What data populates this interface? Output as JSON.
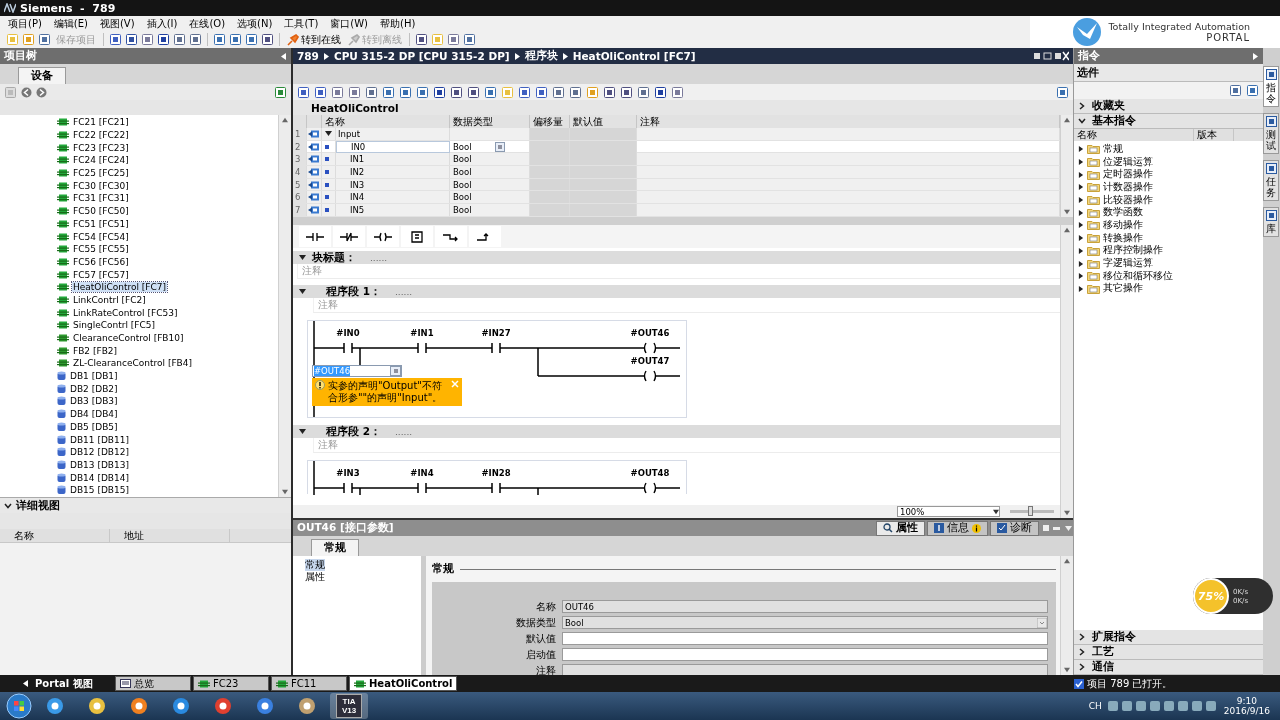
{
  "title_bar": {
    "title": "Siemens  -  789"
  },
  "brand": {
    "line1": "Totally Integrated Automation",
    "line2": "PORTAL"
  },
  "menu": [
    "项目(P)",
    "编辑(E)",
    "视图(V)",
    "插入(I)",
    "在线(O)",
    "选项(N)",
    "工具(T)",
    "窗口(W)",
    "帮助(H)"
  ],
  "toolbar": {
    "buttons": [
      {
        "label": "保存项目",
        "disabled": true
      },
      {
        "label": "转到在线",
        "disabled": false
      },
      {
        "label": "转到离线",
        "disabled": true
      }
    ]
  },
  "project_tree": {
    "title": "项目树",
    "tab": "设备",
    "items": [
      {
        "label": "FC21 [FC21]",
        "kind": "fc",
        "selected": false
      },
      {
        "label": "FC22 [FC22]",
        "kind": "fc",
        "selected": false
      },
      {
        "label": "FC23 [FC23]",
        "kind": "fc",
        "selected": false
      },
      {
        "label": "FC24 [FC24]",
        "kind": "fc",
        "selected": false
      },
      {
        "label": "FC25 [FC25]",
        "kind": "fc",
        "selected": false
      },
      {
        "label": "FC30 [FC30]",
        "kind": "fc",
        "selected": false
      },
      {
        "label": "FC31 [FC31]",
        "kind": "fc",
        "selected": false
      },
      {
        "label": "FC50 [FC50]",
        "kind": "fc",
        "selected": false
      },
      {
        "label": "FC51 [FC51]",
        "kind": "fc",
        "selected": false
      },
      {
        "label": "FC54 [FC54]",
        "kind": "fc",
        "selected": false
      },
      {
        "label": "FC55 [FC55]",
        "kind": "fc",
        "selected": false
      },
      {
        "label": "FC56 [FC56]",
        "kind": "fc",
        "selected": false
      },
      {
        "label": "FC57 [FC57]",
        "kind": "fc",
        "selected": false
      },
      {
        "label": "HeatOliControl [FC7]",
        "kind": "fc",
        "selected": true
      },
      {
        "label": "LinkContrl [FC2]",
        "kind": "fc",
        "selected": false
      },
      {
        "label": "LinkRateControl [FC53]",
        "kind": "fc",
        "selected": false
      },
      {
        "label": "SingleContrl [FC5]",
        "kind": "fc",
        "selected": false
      },
      {
        "label": "ClearanceControl [FB10]",
        "kind": "fb",
        "selected": false
      },
      {
        "label": "FB2 [FB2]",
        "kind": "fb",
        "selected": false
      },
      {
        "label": "ZL-ClearanceControl [FB4]",
        "kind": "fb",
        "selected": false
      },
      {
        "label": "DB1 [DB1]",
        "kind": "db",
        "selected": false
      },
      {
        "label": "DB2 [DB2]",
        "kind": "db",
        "selected": false
      },
      {
        "label": "DB3 [DB3]",
        "kind": "db",
        "selected": false
      },
      {
        "label": "DB4 [DB4]",
        "kind": "db",
        "selected": false
      },
      {
        "label": "DB5 [DB5]",
        "kind": "db",
        "selected": false
      },
      {
        "label": "DB11 [DB11]",
        "kind": "db",
        "selected": false
      },
      {
        "label": "DB12 [DB12]",
        "kind": "db",
        "selected": false
      },
      {
        "label": "DB13 [DB13]",
        "kind": "db",
        "selected": false
      },
      {
        "label": "DB14 [DB14]",
        "kind": "db",
        "selected": false
      },
      {
        "label": "DB15 [DB15]",
        "kind": "db",
        "selected": false
      }
    ]
  },
  "detail_view": {
    "title": "详细视图",
    "expanded": true,
    "columns": [
      "名称",
      "地址"
    ]
  },
  "editor": {
    "breadcrumb": [
      "789",
      "CPU 315-2 DP [CPU 315-2 DP]",
      "程序块",
      "HeatOliControl [FC7]"
    ],
    "block_name": "HeatOliControl",
    "interface": {
      "columns": [
        "名称",
        "数据类型",
        "偏移量",
        "默认值",
        "注释"
      ],
      "rows": [
        {
          "index": "1",
          "kind": "section",
          "name": "Input",
          "expanded": true,
          "selected": false
        },
        {
          "index": "2",
          "kind": "param",
          "name": "IN0",
          "type": "Bool",
          "selected": true
        },
        {
          "index": "3",
          "kind": "param",
          "name": "IN1",
          "type": "Bool",
          "selected": false
        },
        {
          "index": "4",
          "kind": "param",
          "name": "IN2",
          "type": "Bool",
          "selected": false
        },
        {
          "index": "5",
          "kind": "param",
          "name": "IN3",
          "type": "Bool",
          "selected": false
        },
        {
          "index": "6",
          "kind": "param",
          "name": "IN4",
          "type": "Bool",
          "selected": false
        },
        {
          "index": "7",
          "kind": "param",
          "name": "IN5",
          "type": "Bool",
          "selected": false
        }
      ]
    },
    "block_title": {
      "label": "块标题：",
      "placeholder": "......",
      "comment": "注释",
      "expanded": true
    },
    "networks": [
      {
        "label": "程序段 1：",
        "placeholder": "......",
        "comment": "注释",
        "expanded": true,
        "contacts": [
          "#IN0",
          "#IN1",
          "#IN27"
        ],
        "coils": [
          "#OUT46",
          "#OUT47"
        ],
        "edit": {
          "value": "#OUT46",
          "error": "实参的声明\"Output\"不符合形参\"\"的声明\"Input\"。"
        }
      },
      {
        "label": "程序段 2：",
        "placeholder": "......",
        "comment": "注释",
        "expanded": true,
        "contacts": [
          "#IN3",
          "#IN4",
          "#IN28"
        ],
        "coils": [
          "#OUT48"
        ]
      }
    ],
    "zoom": {
      "value": "100%",
      "level": 0.45
    }
  },
  "properties": {
    "title": "OUT46 [接口参数]",
    "tabs": [
      {
        "label": "属性",
        "kind": "properties",
        "selected": true
      },
      {
        "label": "信息",
        "kind": "info",
        "selected": false
      },
      {
        "label": "诊断",
        "kind": "diagnostics",
        "selected": false
      }
    ],
    "section_tab": "常规",
    "nav": [
      {
        "label": "常规",
        "selected": true
      },
      {
        "label": "属性",
        "selected": false
      }
    ],
    "heading": "常规",
    "fields": [
      {
        "label": "名称",
        "value": "OUT46",
        "disabled": true,
        "kind": "text"
      },
      {
        "label": "数据类型",
        "value": "Bool",
        "disabled": true,
        "kind": "dropdown"
      },
      {
        "label": "默认值",
        "disabled": false,
        "kind": "text"
      },
      {
        "label": "启动值",
        "disabled": false,
        "kind": "text"
      },
      {
        "label": "注释",
        "disabled": true,
        "kind": "text"
      }
    ]
  },
  "instructions": {
    "title": "指令",
    "options": "选件",
    "sections": [
      {
        "label": "收藏夹",
        "expanded": false
      },
      {
        "label": "基本指令",
        "expanded": true
      }
    ],
    "columns": [
      "名称",
      "版本"
    ],
    "items": [
      "常规",
      "位逻辑运算",
      "定时器操作",
      "计数器操作",
      "比较器操作",
      "数学函数",
      "移动操作",
      "转换操作",
      "程序控制操作",
      "字逻辑运算",
      "移位和循环移位",
      "其它操作"
    ],
    "bottom_sections": [
      {
        "label": "扩展指令",
        "expanded": false
      },
      {
        "label": "工艺",
        "expanded": false
      },
      {
        "label": "通信",
        "expanded": false
      }
    ]
  },
  "side_tabs": [
    {
      "label": "指令",
      "selected": true
    },
    {
      "label": "测试",
      "selected": false
    },
    {
      "label": "任务",
      "selected": false
    },
    {
      "label": "库",
      "selected": false
    }
  ],
  "speed_widget": {
    "percent": "75%",
    "upload": "0K/s",
    "download": "0K/s"
  },
  "portal_bar": {
    "portal": "Portal 视图",
    "tabs": [
      {
        "label": "总览",
        "kind": "overview",
        "selected": false
      },
      {
        "label": "FC23",
        "kind": "block",
        "selected": false
      },
      {
        "label": "FC11",
        "kind": "block",
        "selected": false
      },
      {
        "label": "HeatOliControl",
        "kind": "block",
        "selected": true
      }
    ],
    "status": "项目 789 已打开。"
  },
  "taskbar": {
    "tia": [
      "TIA",
      "V13"
    ],
    "lang": "CH",
    "time": "9:10",
    "date": "2016/9/16"
  }
}
